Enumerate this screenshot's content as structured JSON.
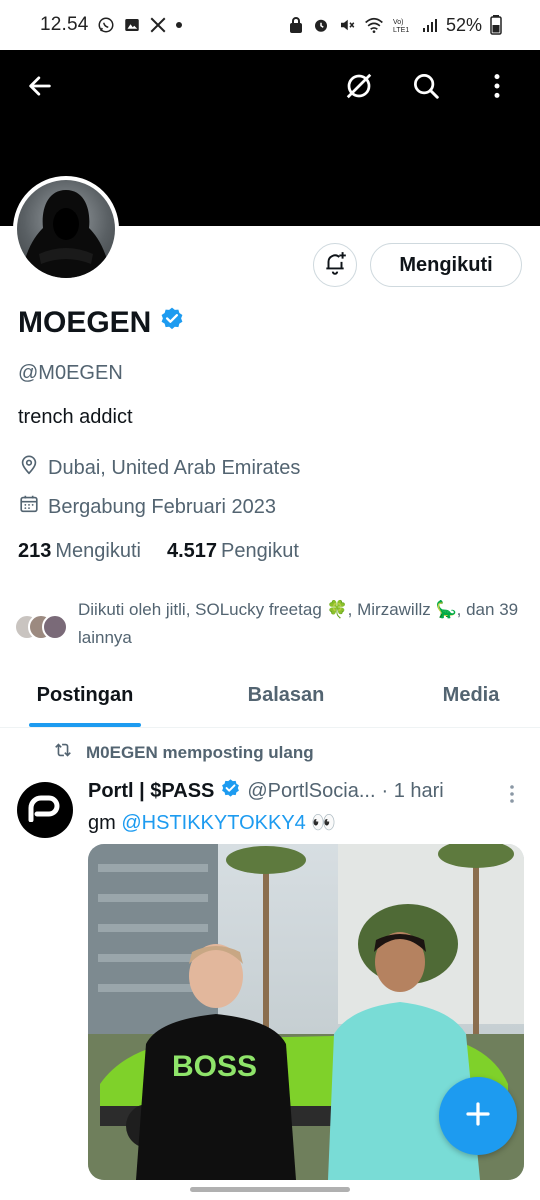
{
  "status_bar": {
    "time": "12.54",
    "battery": "52%",
    "left_icons": [
      "whatsapp-icon",
      "gallery-icon",
      "x-logo-icon",
      "dot-icon"
    ],
    "right_icons": [
      "lock-icon",
      "alarm-icon",
      "mute-icon",
      "wifi-icon",
      "volte-lte-icon",
      "signal-icon",
      "battery-icon"
    ]
  },
  "top_bar": {
    "icons": [
      "back-arrow-icon",
      "grok-icon",
      "search-icon",
      "more-vertical-icon"
    ]
  },
  "profile": {
    "follow_button": "Mengikuti",
    "name": "MOEGEN",
    "handle": "@M0EGEN",
    "bio": "trench addict",
    "location": "Dubai, United Arab Emirates",
    "joined": "Bergabung Februari 2023",
    "following_count": "213",
    "following_label": "Mengikuti",
    "followers_count": "4.517",
    "followers_label": "Pengikut",
    "followed_by": "Diikuti oleh jitli, SOLucky freetag 🍀, Mirzawillz 🦕, dan 39 lainnya"
  },
  "tabs": [
    {
      "label": "Postingan",
      "active": true
    },
    {
      "label": "Balasan",
      "active": false
    },
    {
      "label": "Media",
      "active": false
    }
  ],
  "post": {
    "repost_label": "M0EGEN memposting ulang",
    "author_name": "Portl | $PASS",
    "author_handle": "@PortlSocia...",
    "time": "· 1 hari",
    "text_prefix": "gm",
    "mention": "@HSTIKKYTOKKY4",
    "emoji": "👀",
    "shirt_text": "BOSS"
  },
  "colors": {
    "accent": "#1d9bf0",
    "verified": "#1d9bf0",
    "text_primary": "#0f1419",
    "text_secondary": "#536471",
    "banner": "#000000"
  }
}
